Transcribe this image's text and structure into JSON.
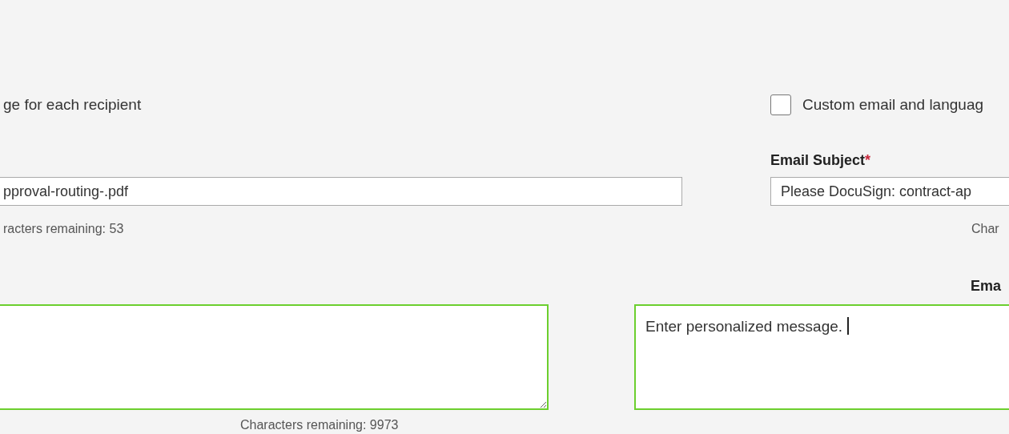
{
  "recipient_option": {
    "label": "ge for each recipient"
  },
  "custom_email": {
    "label": "Custom email and languag",
    "checked": false
  },
  "document_name": {
    "value": "pproval-routing-.pdf",
    "remaining": "racters remaining: 53"
  },
  "email_subject": {
    "label": "Email Subject",
    "required": "*",
    "value": "Please DocuSign: contract-ap",
    "remaining": "Char"
  },
  "message_left": {
    "remaining": "Characters remaining: 9973"
  },
  "message_right": {
    "label": "Ema",
    "value": "Enter personalized message."
  }
}
